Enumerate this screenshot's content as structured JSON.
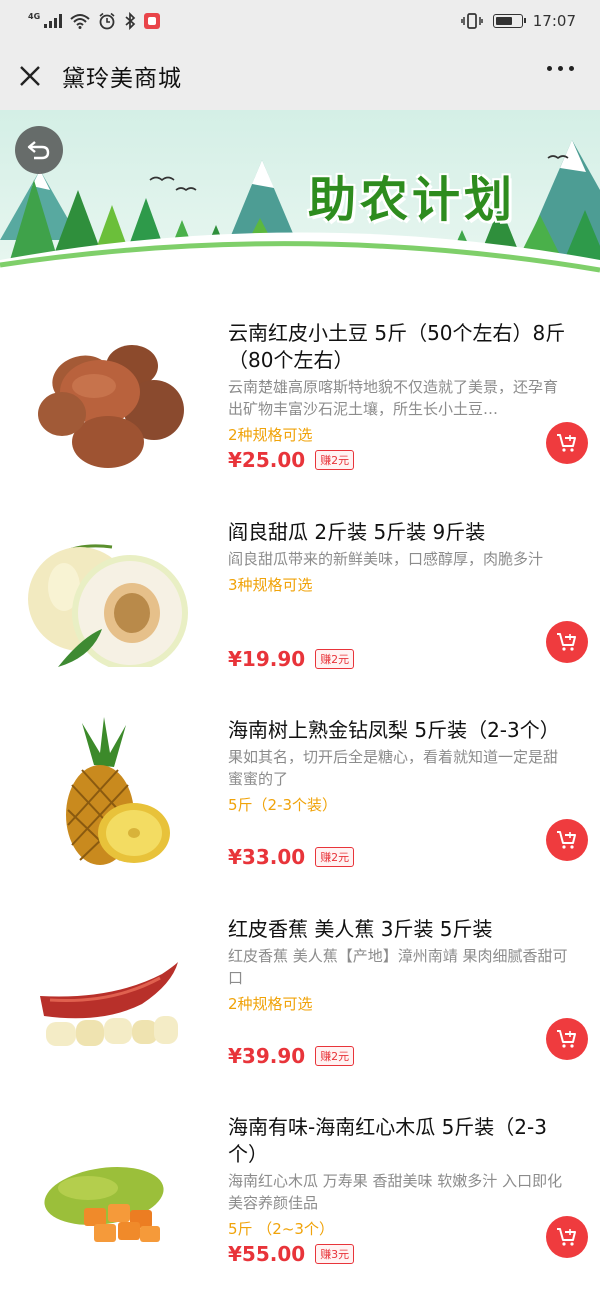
{
  "status_bar": {
    "network": "4G",
    "time": "17:07",
    "battery_level": 0.6
  },
  "nav": {
    "title": "黛玲美商城",
    "close_icon": "close-icon",
    "more_icon": "more-dots-icon"
  },
  "banner": {
    "title": "助农计划",
    "back_icon": "back-arrow-icon"
  },
  "colors": {
    "price": "#e8343a",
    "spec": "#f0a30a",
    "cart": "#ef3b3e",
    "banner_title": "#2e8c1e"
  },
  "products": [
    {
      "title": "云南红皮小土豆 5斤（50个左右）8斤（80个左右）",
      "desc": "云南楚雄高原喀斯特地貌不仅造就了美景，还孕育出矿物丰富沙石泥土壤，所生长小土豆…",
      "spec": "2种规格可选",
      "price": "¥25.00",
      "earn": "赚2元",
      "image": "potato-image"
    },
    {
      "title": "阎良甜瓜 2斤装 5斤装 9斤装",
      "desc": "阎良甜瓜带来的新鲜美味，口感醇厚，肉脆多汁",
      "spec": "3种规格可选",
      "price": "¥19.90",
      "earn": "赚2元",
      "image": "melon-image"
    },
    {
      "title": "海南树上熟金钻凤梨 5斤装（2-3个）",
      "desc": "果如其名，切开后全是糖心，看着就知道一定是甜蜜蜜的了",
      "spec": "5斤（2-3个装）",
      "price": "¥33.00",
      "earn": "赚2元",
      "image": "pineapple-image"
    },
    {
      "title": "红皮香蕉 美人蕉 3斤装 5斤装",
      "desc": "红皮香蕉 美人蕉【产地】漳州南靖 果肉细腻香甜可口",
      "spec": "2种规格可选",
      "price": "¥39.90",
      "earn": "赚2元",
      "image": "red-banana-image"
    },
    {
      "title": "海南有味-海南红心木瓜 5斤装（2-3个）",
      "desc": "海南红心木瓜 万寿果 香甜美味 软嫩多汁 入口即化 美容养颜佳品",
      "spec": "5斤 （2~3个）",
      "price": "¥55.00",
      "earn": "赚3元",
      "image": "papaya-image"
    }
  ]
}
